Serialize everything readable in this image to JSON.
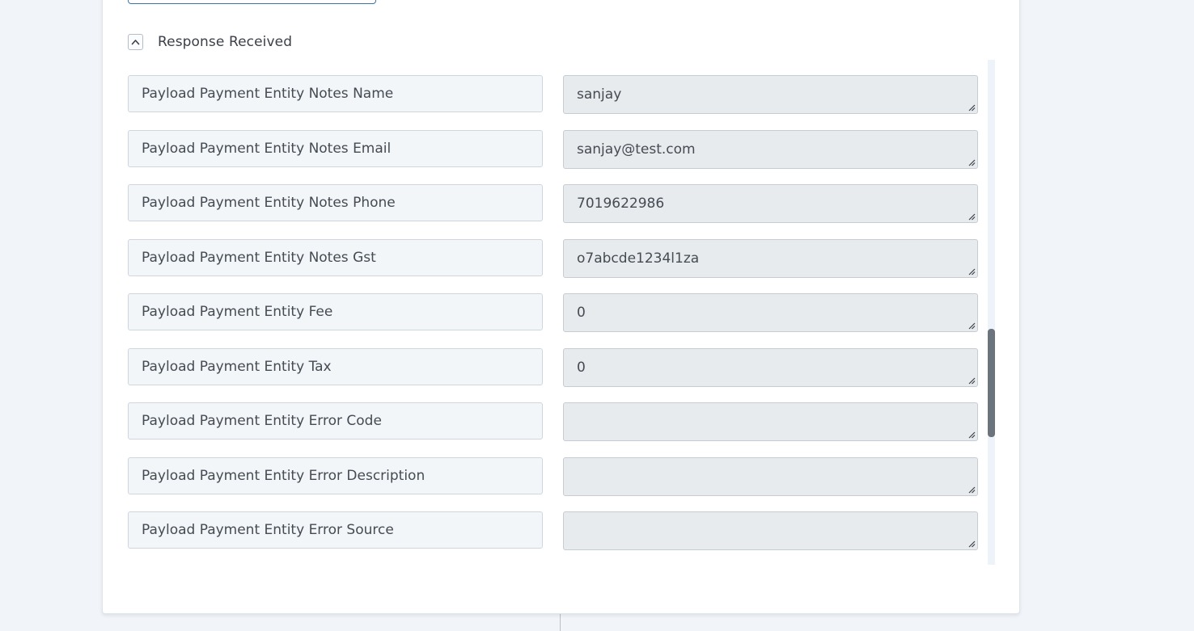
{
  "section": {
    "title": "Response Received",
    "toggle_icon": "chevron-up-icon"
  },
  "fields": [
    {
      "label": "Payload Payment Entity Notes Name",
      "value": "sanjay"
    },
    {
      "label": "Payload Payment Entity Notes Email",
      "value": "sanjay@test.com"
    },
    {
      "label": "Payload Payment Entity Notes Phone",
      "value": "7019622986"
    },
    {
      "label": "Payload Payment Entity Notes Gst",
      "value": "o7abcde1234l1za"
    },
    {
      "label": "Payload Payment Entity Fee",
      "value": "0"
    },
    {
      "label": "Payload Payment Entity Tax",
      "value": "0"
    },
    {
      "label": "Payload Payment Entity Error Code",
      "value": ""
    },
    {
      "label": "Payload Payment Entity Error Description",
      "value": ""
    },
    {
      "label": "Payload Payment Entity Error Source",
      "value": ""
    }
  ],
  "colors": {
    "accent_border": "#3a76a8",
    "label_bg": "#f2f6f9",
    "value_bg": "#e8ebee",
    "scrollbar_thumb": "#6b737c"
  }
}
